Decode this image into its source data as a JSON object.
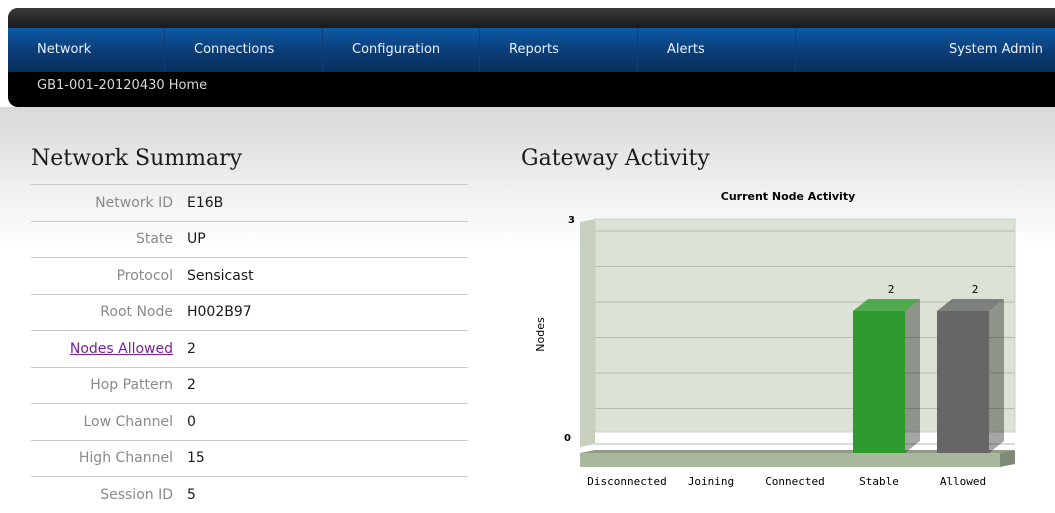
{
  "nav": {
    "items": [
      "Network",
      "Connections",
      "Configuration",
      "Reports",
      "Alerts"
    ],
    "admin": "System Admin"
  },
  "breadcrumb": "GB1-001-20120430 Home",
  "summary": {
    "title": "Network Summary",
    "rows": [
      {
        "label": "Network ID",
        "value": "E16B",
        "link": false
      },
      {
        "label": "State",
        "value": "UP",
        "link": false
      },
      {
        "label": "Protocol",
        "value": "Sensicast",
        "link": false
      },
      {
        "label": "Root Node",
        "value": "H002B97",
        "link": false
      },
      {
        "label": "Nodes Allowed",
        "value": "2",
        "link": true
      },
      {
        "label": "Hop Pattern",
        "value": "2",
        "link": false
      },
      {
        "label": "Low Channel",
        "value": "0",
        "link": false
      },
      {
        "label": "High Channel",
        "value": "15",
        "link": false
      },
      {
        "label": "Session ID",
        "value": "5",
        "link": false
      }
    ]
  },
  "activity": {
    "title": "Gateway Activity"
  },
  "chart_data": {
    "type": "bar",
    "title": "Current Node Activity",
    "ylabel": "Nodes",
    "xlabel": "",
    "categories": [
      "Disconnected",
      "Joining",
      "Connected",
      "Stable",
      "Allowed"
    ],
    "values": [
      0,
      0,
      0,
      2,
      2
    ],
    "ylim": [
      0,
      3
    ],
    "yticks": [
      "0",
      "3"
    ],
    "colors": [
      "#2e9a2e",
      "#2e9a2e",
      "#2e9a2e",
      "#2e9a2e",
      "#666666"
    ],
    "grid": true
  }
}
